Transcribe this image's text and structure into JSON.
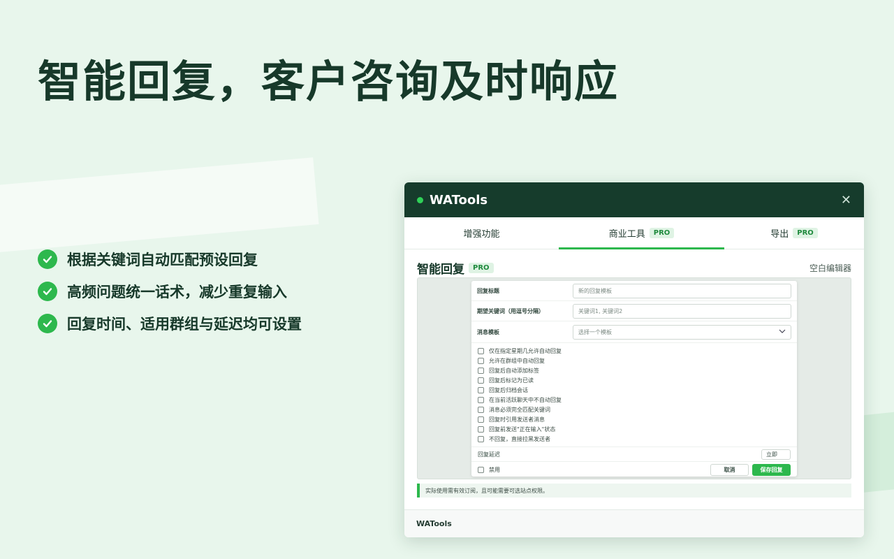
{
  "headline": "智能回复，客户咨询及时响应",
  "features": [
    "根据关键词自动匹配预设回复",
    "高频问题统一话术，减少重复输入",
    "回复时间、适用群组与延迟均可设置"
  ],
  "window": {
    "title": "WATools",
    "tabs": [
      {
        "label": "增强功能",
        "badge": ""
      },
      {
        "label": "商业工具",
        "badge": "PRO"
      },
      {
        "label": "导出",
        "badge": "PRO"
      }
    ],
    "section_title": "智能回复",
    "section_badge": "PRO",
    "blank_editor": "空白编辑器",
    "form": {
      "title_label": "回复标题",
      "title_placeholder": "新的回复模板",
      "keywords_label": "期望关键词（用逗号分隔）",
      "keywords_placeholder": "关键词1, 关键词2",
      "template_label": "消息模板",
      "template_placeholder": "选择一个模板",
      "options": [
        "仅在指定星期几允许自动回复",
        "允许在群组中自动回复",
        "回复后自动添加标签",
        "回复后标记为已读",
        "回复后归档会话",
        "在当前活跃聊天中不自动回复",
        "消息必须完全匹配关键词",
        "回复时引用发送者消息",
        "回复前发送\"正在输入\"状态",
        "不回复，直接拉黑发送者"
      ],
      "delay_label": "回复延迟",
      "delay_value": "立即",
      "disable_label": "禁用",
      "cancel_label": "取消",
      "save_label": "保存回复"
    },
    "notice": "实际使用需有效订阅，且可能需要可选站点权限。",
    "footer": "WATools"
  },
  "colors": {
    "accent": "#2db84d",
    "titlebar": "#163c2c",
    "background": "#e8f6ec"
  }
}
